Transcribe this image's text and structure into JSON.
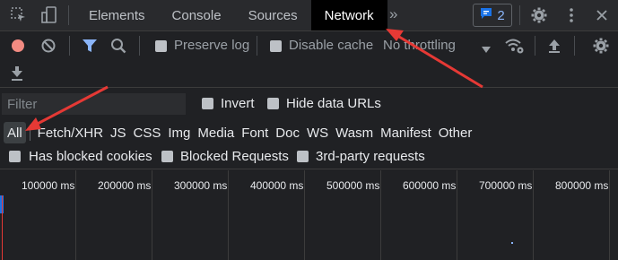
{
  "tabs": [
    {
      "label": "Elements"
    },
    {
      "label": "Console"
    },
    {
      "label": "Sources"
    },
    {
      "label": "Network"
    }
  ],
  "more_tabs_glyph": "»",
  "issues_count": "2",
  "toolbar": {
    "preserve_log": "Preserve log",
    "disable_cache": "Disable cache",
    "throttling": "No throttling"
  },
  "filter": {
    "placeholder": "Filter",
    "invert": "Invert",
    "hide_data_urls": "Hide data URLs"
  },
  "types": [
    "All",
    "Fetch/XHR",
    "JS",
    "CSS",
    "Img",
    "Media",
    "Font",
    "Doc",
    "WS",
    "Wasm",
    "Manifest",
    "Other"
  ],
  "block_filters": {
    "blocked_cookies": "Has blocked cookies",
    "blocked_requests": "Blocked Requests",
    "third_party": "3rd-party requests"
  },
  "timeline_ticks": [
    "100000 ms",
    "200000 ms",
    "300000 ms",
    "400000 ms",
    "500000 ms",
    "600000 ms",
    "700000 ms",
    "800000 ms"
  ],
  "colors": {
    "annotation_arrow": "#e53935",
    "active_tab_bg": "#000000",
    "accent_blue": "#8ab4f8",
    "record_red": "#f28b82"
  },
  "icons": [
    "inspect-icon",
    "device-toggle-icon",
    "more-tabs-icon",
    "issues-icon",
    "gear-icon",
    "kebab-menu-icon",
    "record-icon",
    "clear-icon",
    "filter-icon",
    "search-icon",
    "wifi-settings-icon",
    "import-icon",
    "export-icon",
    "network-settings-icon"
  ]
}
